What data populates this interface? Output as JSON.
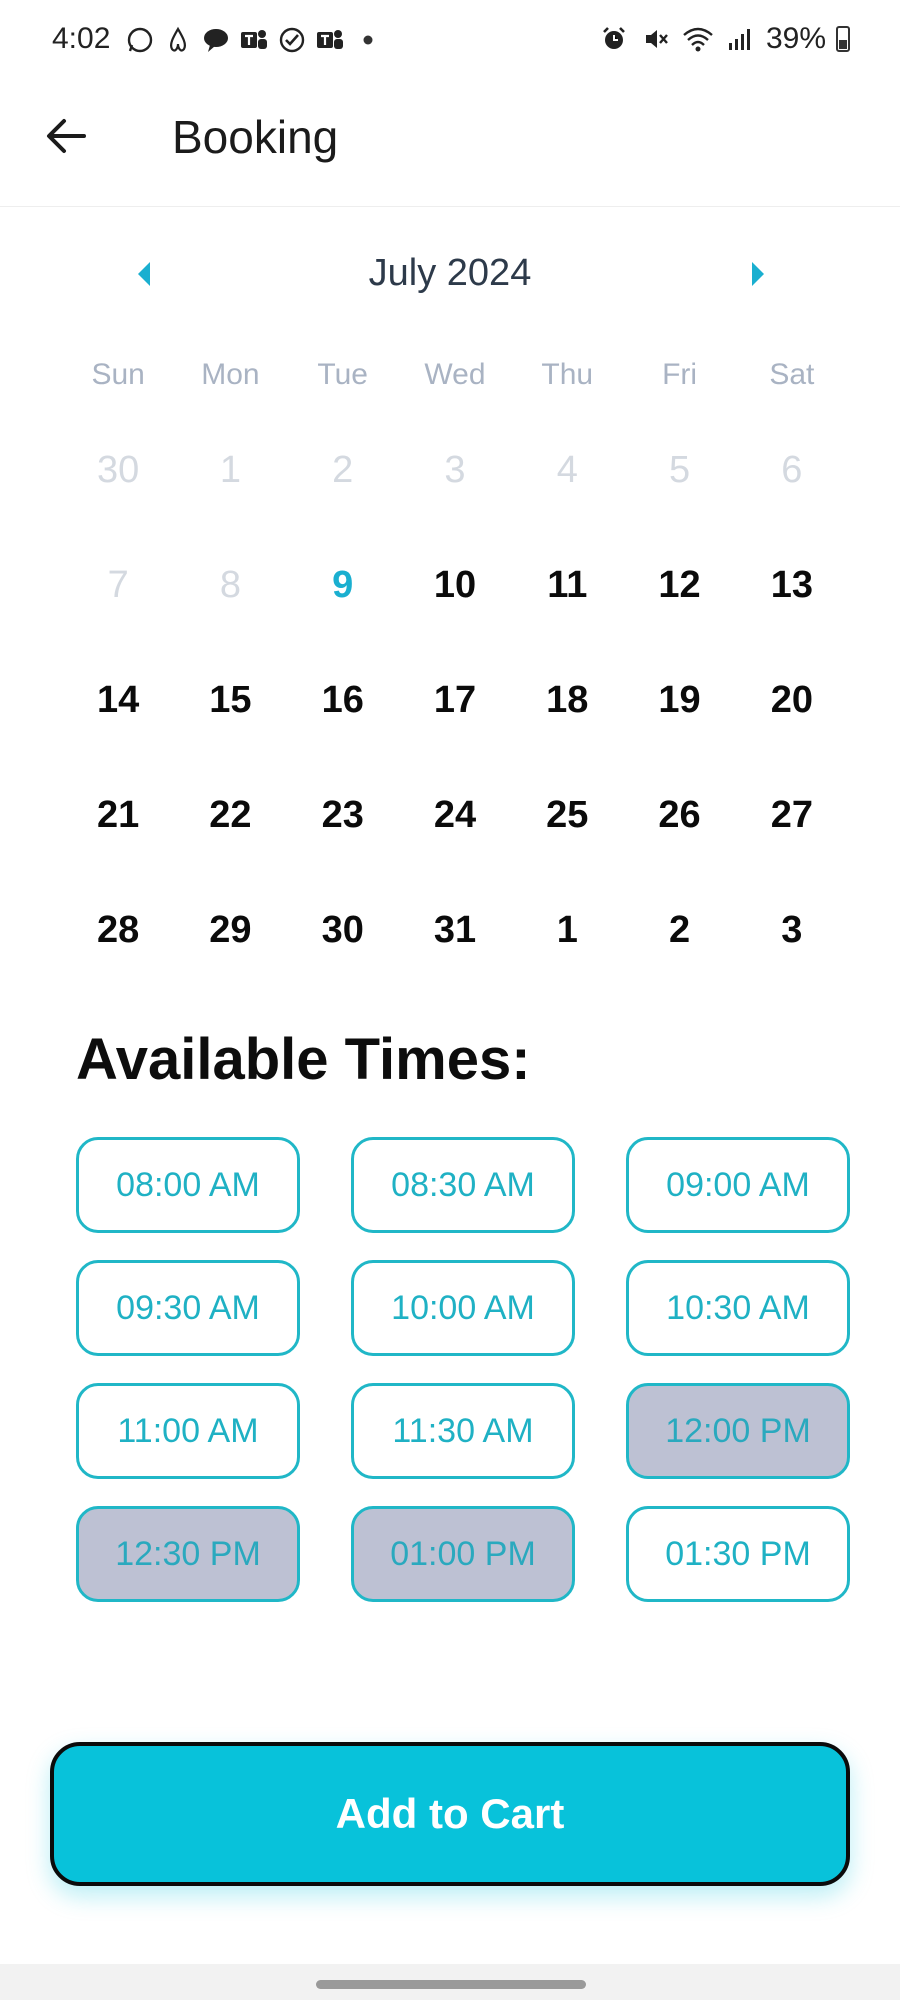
{
  "status_bar": {
    "time": "4:02",
    "battery": "39%",
    "left_icons": [
      "whatsapp-icon",
      "airbnb-icon",
      "chat-icon",
      "teams-icon",
      "check-circle-icon",
      "teams-icon",
      "dot-icon"
    ],
    "right_icons": [
      "alarm-icon",
      "mute-icon",
      "wifi-icon",
      "signal-icon",
      "battery-icon"
    ]
  },
  "header": {
    "title": "Booking",
    "back_icon": "arrow-left-icon"
  },
  "calendar": {
    "month_label": "July 2024",
    "weekdays": [
      "Sun",
      "Mon",
      "Tue",
      "Wed",
      "Thu",
      "Fri",
      "Sat"
    ],
    "days": [
      {
        "label": "30",
        "state": "disabled"
      },
      {
        "label": "1",
        "state": "disabled"
      },
      {
        "label": "2",
        "state": "disabled"
      },
      {
        "label": "3",
        "state": "disabled"
      },
      {
        "label": "4",
        "state": "disabled"
      },
      {
        "label": "5",
        "state": "disabled"
      },
      {
        "label": "6",
        "state": "disabled"
      },
      {
        "label": "7",
        "state": "disabled"
      },
      {
        "label": "8",
        "state": "disabled"
      },
      {
        "label": "9",
        "state": "selected"
      },
      {
        "label": "10",
        "state": "active"
      },
      {
        "label": "11",
        "state": "active"
      },
      {
        "label": "12",
        "state": "active"
      },
      {
        "label": "13",
        "state": "active"
      },
      {
        "label": "14",
        "state": "active"
      },
      {
        "label": "15",
        "state": "active"
      },
      {
        "label": "16",
        "state": "active"
      },
      {
        "label": "17",
        "state": "active"
      },
      {
        "label": "18",
        "state": "active"
      },
      {
        "label": "19",
        "state": "active"
      },
      {
        "label": "20",
        "state": "active"
      },
      {
        "label": "21",
        "state": "active"
      },
      {
        "label": "22",
        "state": "active"
      },
      {
        "label": "23",
        "state": "active"
      },
      {
        "label": "24",
        "state": "active"
      },
      {
        "label": "25",
        "state": "active"
      },
      {
        "label": "26",
        "state": "active"
      },
      {
        "label": "27",
        "state": "active"
      },
      {
        "label": "28",
        "state": "active"
      },
      {
        "label": "29",
        "state": "active"
      },
      {
        "label": "30",
        "state": "active"
      },
      {
        "label": "31",
        "state": "active"
      },
      {
        "label": "1",
        "state": "active"
      },
      {
        "label": "2",
        "state": "active"
      },
      {
        "label": "3",
        "state": "active"
      }
    ]
  },
  "times": {
    "title": "Available Times:",
    "slots": [
      {
        "label": "08:00 AM",
        "available": true
      },
      {
        "label": "08:30 AM",
        "available": true
      },
      {
        "label": "09:00 AM",
        "available": true
      },
      {
        "label": "09:30 AM",
        "available": true
      },
      {
        "label": "10:00 AM",
        "available": true
      },
      {
        "label": "10:30 AM",
        "available": true
      },
      {
        "label": "11:00 AM",
        "available": true
      },
      {
        "label": "11:30 AM",
        "available": true
      },
      {
        "label": "12:00 PM",
        "available": false
      },
      {
        "label": "12:30 PM",
        "available": false
      },
      {
        "label": "01:00 PM",
        "available": false
      },
      {
        "label": "01:30 PM",
        "available": true
      }
    ]
  },
  "cart": {
    "label": "Add to Cart"
  },
  "colors": {
    "accent": "#08c2da",
    "selected_day": "#1aafd0",
    "slot_border": "#20b7c7",
    "unavailable_slot": "#bdc1d3"
  }
}
